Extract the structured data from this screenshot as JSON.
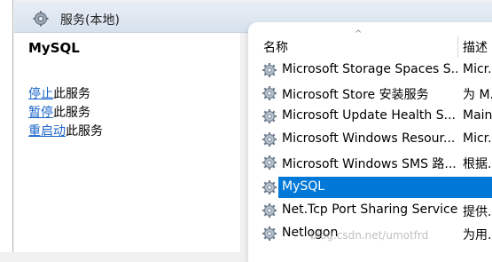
{
  "header": {
    "title": "服务(本地)",
    "icon": "services-gear-icon"
  },
  "left_panel": {
    "service_name": "MySQL",
    "actions": [
      {
        "link": "停止",
        "suffix": "此服务"
      },
      {
        "link": "暂停",
        "suffix": "此服务"
      },
      {
        "link": "重启动",
        "suffix": "此服务"
      }
    ]
  },
  "columns": {
    "name": "名称",
    "description": "描述"
  },
  "services": [
    {
      "name": "Microsoft Storage Spaces S...",
      "description": "Micr..."
    },
    {
      "name": "Microsoft Store 安装服务",
      "description": "为 M..."
    },
    {
      "name": "Microsoft Update Health S...",
      "description": "Main..."
    },
    {
      "name": "Microsoft Windows Resour...",
      "description": "Micr..."
    },
    {
      "name": "Microsoft Windows SMS 路...",
      "description": "根据..."
    },
    {
      "name": "MySQL",
      "description": ""
    },
    {
      "name": "Net.Tcp Port Sharing Service",
      "description": "提供..."
    },
    {
      "name": "Netlogon",
      "description": "为用..."
    }
  ],
  "selected_service": "MySQL",
  "watermark": "blog.csdn.net/umotfrd",
  "colors": {
    "selection": "#0078d7",
    "link": "#1a64c8"
  }
}
